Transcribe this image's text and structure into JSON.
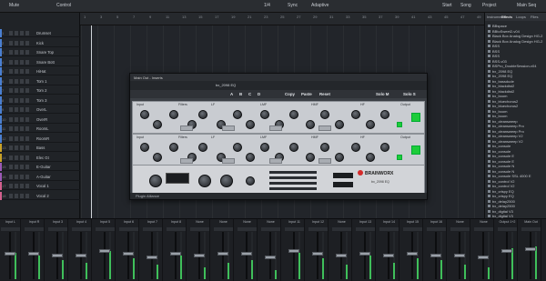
{
  "toolbar": {
    "items": [
      "Mute",
      "Control",
      "1/4",
      "Sync",
      "Adaptive",
      "Start",
      "Song",
      "Project",
      "Main Seq"
    ]
  },
  "ruler": {
    "ticks": [
      "1",
      "3",
      "5",
      "7",
      "9",
      "11",
      "13",
      "15",
      "17",
      "19",
      "21",
      "23",
      "25",
      "27",
      "29",
      "31",
      "33",
      "35",
      "37",
      "39",
      "41",
      "43",
      "45",
      "47",
      "49"
    ]
  },
  "tracks": [
    {
      "num": "1",
      "name": "Drumset",
      "color": "#4a7fd1"
    },
    {
      "num": "2",
      "name": "Kick",
      "color": "#4a7fd1"
    },
    {
      "num": "3",
      "name": "Snare Top",
      "color": "#4a7fd1"
    },
    {
      "num": "4",
      "name": "Snare Bott",
      "color": "#4a7fd1"
    },
    {
      "num": "5",
      "name": "HiHat",
      "color": "#4a7fd1"
    },
    {
      "num": "6",
      "name": "Tom 1",
      "color": "#4a7fd1"
    },
    {
      "num": "7",
      "name": "Tom 2",
      "color": "#4a7fd1"
    },
    {
      "num": "8",
      "name": "Tom 3",
      "color": "#4a7fd1"
    },
    {
      "num": "9",
      "name": "OverL",
      "color": "#4a7fd1"
    },
    {
      "num": "10",
      "name": "OverR",
      "color": "#4a7fd1"
    },
    {
      "num": "11",
      "name": "RoomL",
      "color": "#4a7fd1"
    },
    {
      "num": "12",
      "name": "RoomR",
      "color": "#4a7fd1"
    },
    {
      "num": "13",
      "name": "Bass",
      "color": "#c9a227"
    },
    {
      "num": "14",
      "name": "Elec Gt",
      "color": "#c9a227"
    },
    {
      "num": "15",
      "name": "E-Guitar",
      "color": "#9b59b6"
    },
    {
      "num": "16",
      "name": "A-Guitar",
      "color": "#9b59b6"
    },
    {
      "num": "17",
      "name": "Vocal 1",
      "color": "#d35f8d"
    },
    {
      "num": "18",
      "name": "Vocal 2",
      "color": "#d35f8d"
    }
  ],
  "browser": {
    "tabs": [
      "Instruments",
      "Effects",
      "Loops",
      "Files"
    ],
    "items": [
      "BBspace",
      "BBtoSweet2-v04",
      "Black Box Analog Design HG-2",
      "Black Box Analog Design HG-2",
      "BSS",
      "BSS",
      "BSS",
      "BSS-v03",
      "BSPro_DoubleSession-v04",
      "bx_2098 EQ",
      "bx_2098 EQ",
      "bx_bassdude",
      "bx_blackdist2",
      "bx_blackdist2",
      "bx_boom",
      "bx_bluechorus2",
      "bx_bluechorus2",
      "bx_boom",
      "bx_boom",
      "bx_cleansweep",
      "bx_cleansweep Pro",
      "bx_cleansweep Pro",
      "bx_cleansweep V2",
      "bx_cleansweep V2",
      "bx_console",
      "bx_console",
      "bx_console E",
      "bx_console E",
      "bx_console N",
      "bx_console N",
      "bx_console SSL 4000 E",
      "bx_control V2",
      "bx_control V2",
      "bx_crispy EQ",
      "bx_crispy EQ",
      "bx_delay2500",
      "bx_delay2500",
      "bx_digital V3",
      "bx_digital V3"
    ]
  },
  "plugin": {
    "window_title": "Main Out - Inserts",
    "preset": "bx_2098 EQ",
    "actions": [
      "A",
      "B",
      "C",
      "D",
      "Copy",
      "Paste",
      "Reset",
      "Solo M",
      "Solo S"
    ],
    "band_labels": [
      "Input",
      "Filters",
      "LF",
      "LMF",
      "HMF",
      "HF",
      "Output"
    ],
    "brand": "BRAINWORX",
    "model": "bx_2098 EQ",
    "footer": "Plugin Alliance"
  },
  "mixer": {
    "strips": [
      {
        "name": "Input L",
        "level": 0.55,
        "cap": 0.45
      },
      {
        "name": "Input R",
        "level": 0.5,
        "cap": 0.45
      },
      {
        "name": "Input 3",
        "level": 0.4,
        "cap": 0.5
      },
      {
        "name": "Input 4",
        "level": 0.35,
        "cap": 0.5
      },
      {
        "name": "Input 5",
        "level": 0.6,
        "cap": 0.4
      },
      {
        "name": "Input 6",
        "level": 0.45,
        "cap": 0.45
      },
      {
        "name": "Input 7",
        "level": 0.3,
        "cap": 0.55
      },
      {
        "name": "Input 8",
        "level": 0.5,
        "cap": 0.45
      },
      {
        "name": "None",
        "level": 0.25,
        "cap": 0.5
      },
      {
        "name": "None",
        "level": 0.35,
        "cap": 0.45
      },
      {
        "name": "None",
        "level": 0.4,
        "cap": 0.45
      },
      {
        "name": "None",
        "level": 0.2,
        "cap": 0.55
      },
      {
        "name": "Input 11",
        "level": 0.55,
        "cap": 0.4
      },
      {
        "name": "Input 12",
        "level": 0.45,
        "cap": 0.45
      },
      {
        "name": "None",
        "level": 0.3,
        "cap": 0.5
      },
      {
        "name": "Input 13",
        "level": 0.5,
        "cap": 0.45
      },
      {
        "name": "Input 14",
        "level": 0.35,
        "cap": 0.5
      },
      {
        "name": "Input 15",
        "level": 0.45,
        "cap": 0.45
      },
      {
        "name": "Input 16",
        "level": 0.4,
        "cap": 0.5
      },
      {
        "name": "None",
        "level": 0.3,
        "cap": 0.5
      },
      {
        "name": "None",
        "level": 0.25,
        "cap": 0.55
      },
      {
        "name": "Output 1+2",
        "level": 0.65,
        "cap": 0.4
      },
      {
        "name": "Main Out",
        "level": 0.7,
        "cap": 0.35
      }
    ]
  },
  "colors": {
    "accent": "#1dcc3a",
    "brand_red": "#d42b2b",
    "meter_green": "#3fbf5a"
  }
}
